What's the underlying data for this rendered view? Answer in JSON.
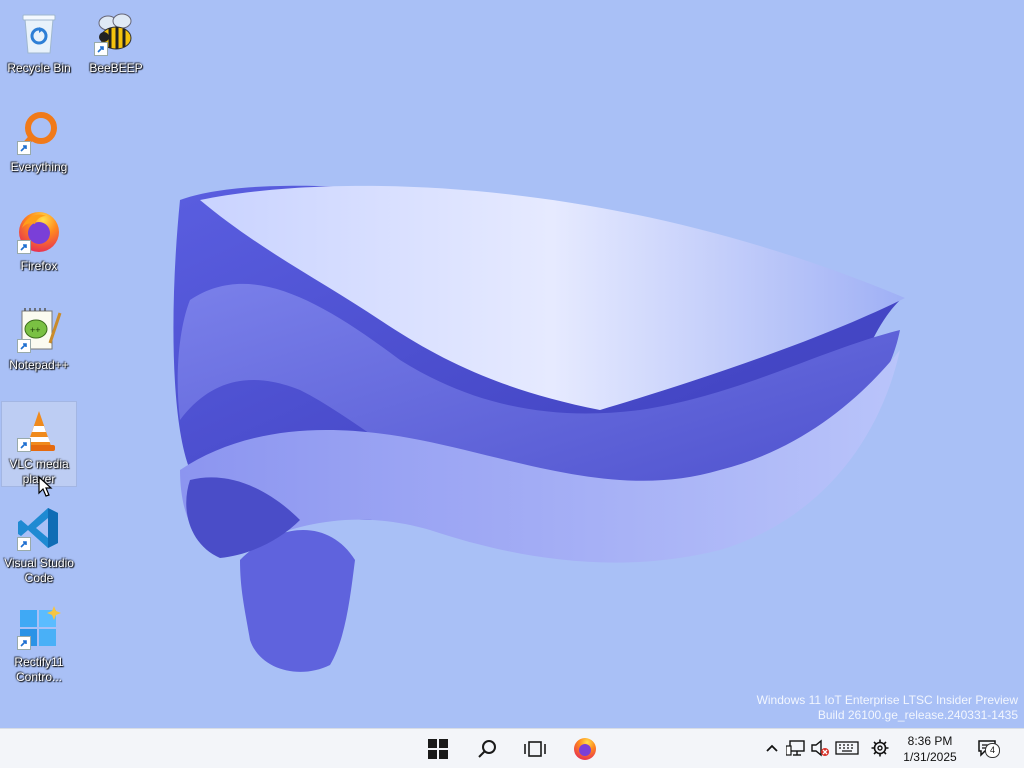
{
  "desktop": {
    "background_color": "#a9c0f6",
    "icons": [
      {
        "label": "Recycle Bin",
        "icon": "recycle-bin-icon"
      },
      {
        "label": "BeeBEEP",
        "icon": "beebeep-icon"
      },
      {
        "label": "Everything",
        "icon": "everything-search-icon"
      },
      {
        "label": "Firefox",
        "icon": "firefox-icon"
      },
      {
        "label": "Notepad++",
        "icon": "notepad-plus-plus-icon"
      },
      {
        "label": "VLC media player",
        "icon": "vlc-cone-icon"
      },
      {
        "label": "Visual Studio Code",
        "icon": "vscode-icon"
      },
      {
        "label": "Rectify11 Contro...",
        "icon": "rectify11-icon"
      }
    ],
    "watermark": {
      "line1": "Windows 11 IoT Enterprise LTSC Insider Preview",
      "line2": "Build 26100.ge_release.240331-1435"
    }
  },
  "taskbar": {
    "buttons": [
      "start-windows-icon",
      "search-icon",
      "task-view-icon",
      "firefox-icon"
    ],
    "tray": {
      "icons": [
        "chevron-up-icon",
        "network-icon",
        "volume-muted-icon",
        "keyboard-icon",
        "settings-gear-icon"
      ],
      "time": "8:36 PM",
      "date": "1/31/2025",
      "notification_count": "4"
    }
  }
}
